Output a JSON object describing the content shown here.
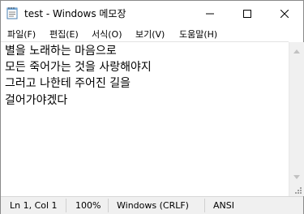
{
  "window": {
    "title": "test - Windows 메모장"
  },
  "menu": {
    "items": [
      {
        "label": "파일(F)"
      },
      {
        "label": "편집(E)"
      },
      {
        "label": "서식(O)"
      },
      {
        "label": "보기(V)"
      },
      {
        "label": "도움말(H)"
      }
    ]
  },
  "editor": {
    "lines": [
      "별을 노래하는 마음으로",
      "모든 죽어가는 것을 사랑해야지",
      "그러고 나한테 주어진 길을",
      "걸어가야겠다"
    ]
  },
  "status": {
    "position": "Ln 1, Col 1",
    "zoom": "100%",
    "line_ending": "Windows (CRLF)",
    "encoding": "ANSI"
  },
  "colors": {
    "background": "#ffffff",
    "statusbar": "#f0f0f0",
    "text": "#000000"
  },
  "icons": {
    "app": "notepad-icon",
    "minimize": "minimize-icon",
    "maximize": "maximize-icon",
    "close": "close-icon",
    "scroll_up": "arrow-up-icon",
    "scroll_down": "arrow-down-icon",
    "size_grip": "size-grip-icon"
  }
}
